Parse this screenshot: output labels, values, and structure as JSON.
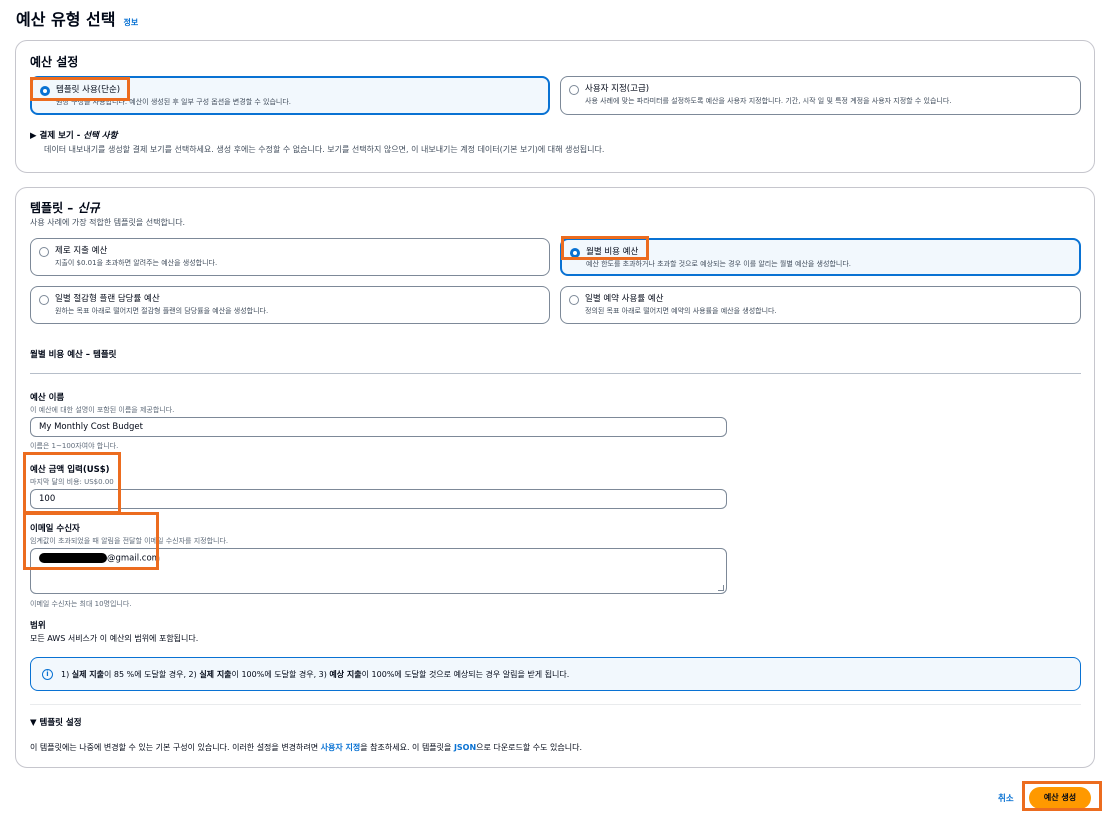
{
  "header": {
    "title": "예산 유형 선택",
    "info": "정보"
  },
  "budget_settings": {
    "title": "예산 설정",
    "options": [
      {
        "label": "템플릿 사용(단순)",
        "desc": "권장 구성을 사용합니다. 예산이 생성된 후 일부 구성 옵션을 변경할 수 있습니다.",
        "selected": true
      },
      {
        "label": "사용자 지정(고급)",
        "desc": "사용 사례에 맞는 파라미터를 설정하도록 예산을 사용자 지정합니다. 기간, 시작 일 및 특정 계정을 사용자 지정할 수 있습니다.",
        "selected": false
      }
    ],
    "billing_view": {
      "title_prefix": "결제 보기 - ",
      "title_italic": "선택 사항",
      "desc": "데이터 내보내기를 생성할 결제 보기를 선택하세요. 생성 후에는 수정할 수 없습니다. 보기를 선택하지 않으면, 이 내보내기는 계정 데이터(기본 보기)에 대해 생성됩니다."
    }
  },
  "templates": {
    "title_prefix": "템플릿 – ",
    "title_italic": "신규",
    "desc": "사용 사례에 가장 적합한 템플릿을 선택합니다.",
    "options": [
      {
        "label": "제로 지출 예산",
        "desc": "지출이 $0.01을 초과하면 알려주는 예산을 생성합니다.",
        "selected": false
      },
      {
        "label": "월별 비용 예산",
        "desc": "예산 한도를 초과하거나 초과할 것으로 예상되는 경우 이를 알리는 월별 예산을 생성합니다.",
        "selected": true
      },
      {
        "label": "일별 절감형 플랜 담당률 예산",
        "desc": "원하는 목표 아래로 떨어지면 절감형 플랜의 담당률을 예산을 생성합니다.",
        "selected": false
      },
      {
        "label": "일별 예약 사용률 예산",
        "desc": "정의된 목표 아래로 떨어지면 예약의 사용률을 예산을 생성합니다.",
        "selected": false
      }
    ]
  },
  "monthly_template": {
    "heading": "월별 비용 예산 – 템플릿",
    "budget_name": {
      "label": "예산 이름",
      "desc": "이 예산에 대한 설명이 포함된 이름을 제공합니다.",
      "value": "My Monthly Cost Budget",
      "hint": "이름은 1~100자여야 합니다."
    },
    "amount": {
      "label": "예산 금액 입력(US$)",
      "desc": "마지막 달의 비용: US$0.00",
      "value": "100"
    },
    "email": {
      "label": "이메일 수신자",
      "desc": "임계값이 초과되었을 때 알림을 전달할 이메일 수신자를 지정합니다.",
      "value_suffix": "@gmail.com",
      "hint": "이메일 수신자는 최대 10명입니다."
    },
    "scope": {
      "label": "범위",
      "desc": "모든 AWS 서비스가 이 예산의 범위에 포함됩니다."
    },
    "alert": {
      "icon": "i",
      "p1": "1) ",
      "b1": "실제 지출",
      "p2": "이 85 %에 도달할 경우, 2) ",
      "b2": "실제 지출",
      "p3": "이 100%에 도달할 경우, 3) ",
      "b3": "예상 지출",
      "p4": "이 100%에 도달할 것으로 예상되는 경우 알림을 받게 됩니다."
    },
    "template_settings": {
      "title": "▼ 템플릿 설정",
      "d1": "이 템플릿에는 나중에 변경할 수 있는 기본 구성이 있습니다. 이러한 설정을 변경하려면 ",
      "link1": "사용자 지정",
      "d2": "을 참조하세요. 이 템플릿을 ",
      "link2": "JSON",
      "d3": "으로 다운로드할 수도 있습니다."
    }
  },
  "footer": {
    "cancel": "취소",
    "create": "예산 생성"
  },
  "colors": {
    "accent": "#0972d3",
    "highlight": "#ec6c1f",
    "primary_button": "#ff9900"
  }
}
